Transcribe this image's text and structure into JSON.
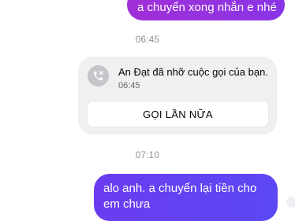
{
  "messages": {
    "outgoing_1": "a chuyển xong nhắn e nhé",
    "timestamp_1": "06:45",
    "missed_call": {
      "title": "An Đạt đã nhỡ cuộc gọi của bạn.",
      "time": "06:45",
      "call_again_label": "GỌI LẦN NỮA",
      "icon": "missed-video-call-icon"
    },
    "timestamp_2": "07:10",
    "outgoing_2": "alo anh. a chuyển lại tiền cho em chưa"
  },
  "colors": {
    "bubble_gradient_start": "#8b2bdc",
    "bubble_gradient_end": "#5a4df4",
    "card_bg": "#f0f0f0",
    "timestamp": "#8a8d91"
  }
}
